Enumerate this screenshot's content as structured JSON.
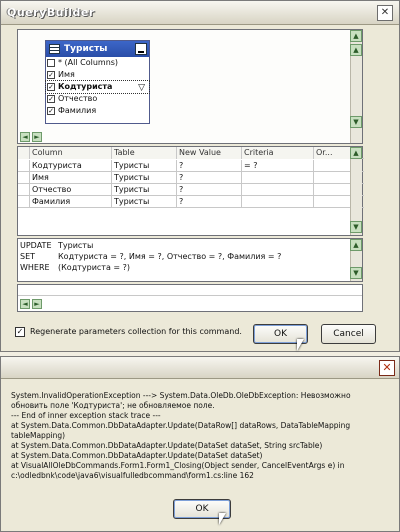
{
  "query_builder": {
    "title": "QueryBuilder",
    "table": {
      "name": "Туристы",
      "fields": [
        {
          "label": "* (All Columns)",
          "checked": false
        },
        {
          "label": "Имя",
          "checked": true
        },
        {
          "label": "Кодтуриста",
          "checked": true,
          "selected": true
        },
        {
          "label": "Отчество",
          "checked": true
        },
        {
          "label": "Фамилия",
          "checked": true
        }
      ]
    },
    "grid": {
      "columns": [
        "Column",
        "Table",
        "New Value",
        "Criteria",
        "Or..."
      ],
      "rows": [
        [
          "Кодтуриста",
          "Туристы",
          "?",
          "= ?",
          ""
        ],
        [
          "Имя",
          "Туристы",
          "?",
          "",
          ""
        ],
        [
          "Отчество",
          "Туристы",
          "?",
          "",
          ""
        ],
        [
          "Фамилия",
          "Туристы",
          "?",
          "",
          ""
        ]
      ]
    },
    "sql": {
      "update_kw": "UPDATE",
      "update_val": "Туристы",
      "set_kw": "SET",
      "set_val": "Кодтуриста = ?, Имя = ?, Отчество = ?, Фамилия = ?",
      "where_kw": "WHERE",
      "where_val": "(Кодтуриста = ?)"
    },
    "regenerate_label": "Regenerate parameters collection for this command.",
    "regenerate_checked": true,
    "ok_label": "OK",
    "cancel_label": "Cancel"
  },
  "error_dialog": {
    "close_glyph": "✕",
    "lines": [
      "System.InvalidOperationException ---> System.Data.OleDb.OleDbException: Невозможно",
      "обновить поле 'Кодтуриста'; не обновляемое поле.",
      "   --- End of inner exception stack trace ---",
      "   at System.Data.Common.DbDataAdapter.Update(DataRow[] dataRows, DataTableMapping",
      "tableMapping)",
      "   at System.Data.Common.DbDataAdapter.Update(DataSet dataSet, String srcTable)",
      "   at System.Data.Common.DbDataAdapter.Update(DataSet dataSet)",
      "   at VisualAllOleDbCommands.Form1.Form1_Closing(Object sender, CancelEventArgs e) in",
      "c:\\odledbnk\\code\\java6\\visualfulledbcommand\\form1.cs:line 162"
    ],
    "ok_label": "OK"
  }
}
